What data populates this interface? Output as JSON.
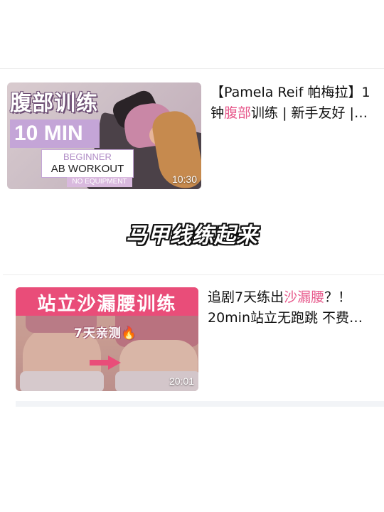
{
  "videos": [
    {
      "title_line1": "【Pamela Reif 帕梅拉】1",
      "title_line2_pre": "钟",
      "title_line2_highlight": "腹部",
      "title_line2_post": "训练 | 新手友好 |…",
      "duration": "10:30",
      "thumbnail": {
        "heading": "腹部训练",
        "time_label": "10 MIN",
        "level": "BEGINNER",
        "workout": "AB WORKOUT",
        "equipment": "NO EQUIPMENT"
      }
    },
    {
      "title_line1_pre": "追剧7天练出",
      "title_line1_highlight": "沙漏腰",
      "title_line1_post": "？！",
      "title_line2": "20min站立无跑跳 不费…",
      "duration": "20:01",
      "thumbnail": {
        "heading": "站立沙漏腰训练",
        "subheading": "7天亲测🔥"
      }
    }
  ],
  "overlay_caption": "马甲线练起来",
  "colors": {
    "highlight": "#e75a8c",
    "banner_pink": "#e94d79",
    "lavender": "#c4a5d7"
  }
}
